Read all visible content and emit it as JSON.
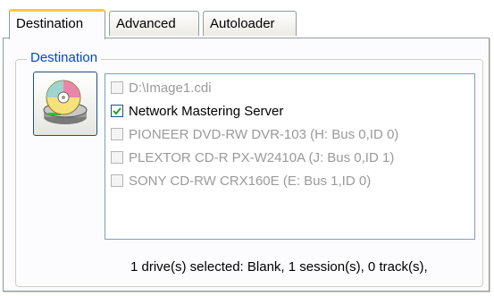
{
  "tabs": [
    {
      "label": "Destination",
      "active": true
    },
    {
      "label": "Advanced",
      "active": false
    },
    {
      "label": "Autoloader",
      "active": false
    }
  ],
  "group": {
    "legend": "Destination"
  },
  "drive_button": {
    "icon": "disc-drive-icon"
  },
  "destinations": [
    {
      "label": "D:\\Image1.cdi",
      "checked": false,
      "enabled": false
    },
    {
      "label": "Network Mastering Server",
      "checked": true,
      "enabled": true
    },
    {
      "label": "PIONEER DVD-RW  DVR-103 (H: Bus 0,ID 0)",
      "checked": false,
      "enabled": false
    },
    {
      "label": "PLEXTOR CD-R   PX-W2410A (J: Bus 0,ID 1)",
      "checked": false,
      "enabled": false
    },
    {
      "label": "SONY CD-RW  CRX160E (E: Bus 1,ID 0)",
      "checked": false,
      "enabled": false
    }
  ],
  "status_text": "1 drive(s) selected: Blank, 1 session(s), 0 track(s),",
  "colors": {
    "accent_tab": "#ffc83c",
    "legend": "#0046d5",
    "check": "#21a121"
  }
}
